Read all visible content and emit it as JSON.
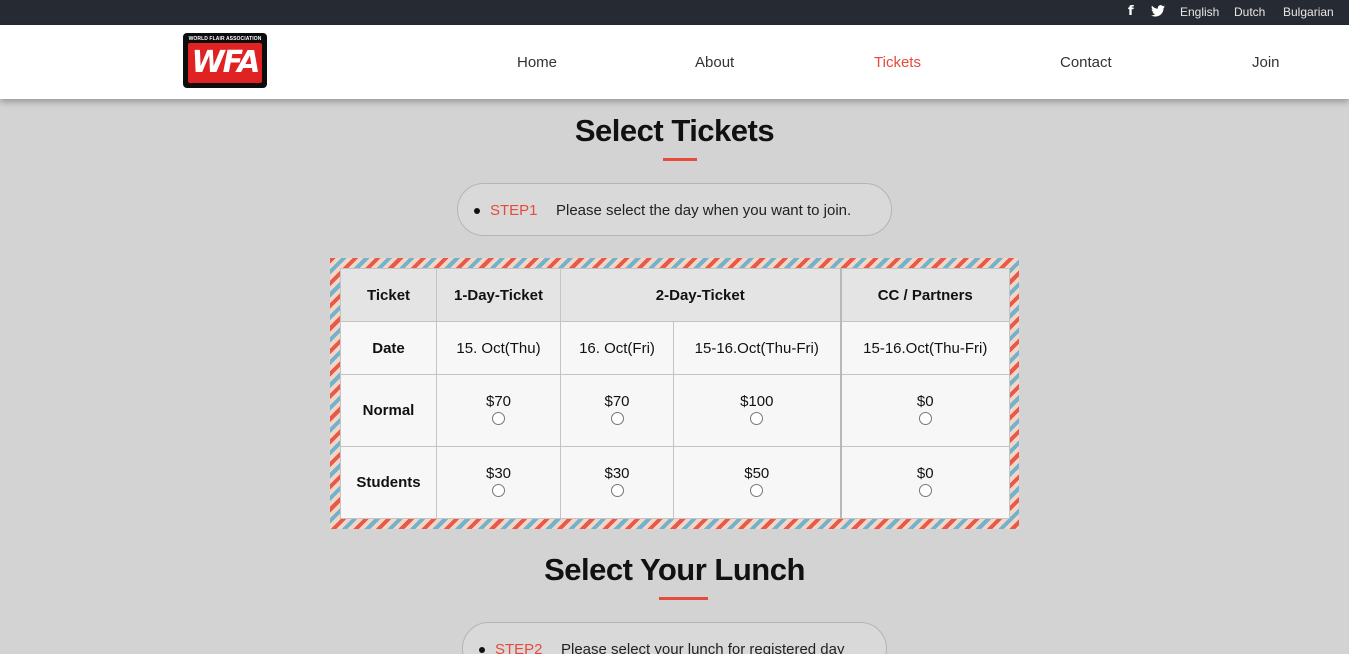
{
  "topbar": {
    "social": [
      {
        "icon": "facebook-icon",
        "glyph": "f"
      },
      {
        "icon": "twitter-icon",
        "glyph": "🐦"
      }
    ],
    "languages": [
      "English",
      "Dutch",
      "Bulgarian"
    ]
  },
  "logo": {
    "top_text": "WORLD FLAIR ASSOCIATION",
    "main_text": "WFA"
  },
  "nav": {
    "items": [
      "Home",
      "About",
      "Tickets",
      "Contact",
      "Join"
    ],
    "active": "Tickets"
  },
  "tickets_section": {
    "title": "Select Tickets",
    "step_label": "STEP1",
    "step_text": "Please select the day when you want to join."
  },
  "ticket_table": {
    "header": [
      "Ticket",
      "1-Day-Ticket",
      "2-Day-Ticket",
      "CC / Partners"
    ],
    "date_row": [
      "Date",
      "15. Oct(Thu)",
      "16. Oct(Fri)",
      "15-16.Oct(Thu-Fri)",
      "15-16.Oct(Thu-Fri)"
    ],
    "rows": [
      {
        "label": "Normal",
        "prices": [
          "$70",
          "$70",
          "$100",
          "$0"
        ]
      },
      {
        "label": "Students",
        "prices": [
          "$30",
          "$30",
          "$50",
          "$0"
        ]
      }
    ]
  },
  "lunch_section": {
    "title": "Select Your Lunch",
    "step_label": "STEP2",
    "step_text": "Please select your lunch for registered day"
  },
  "colors": {
    "accent": "#e64a3c",
    "topbar": "#262a33",
    "page_background": "#d3d3d3"
  }
}
